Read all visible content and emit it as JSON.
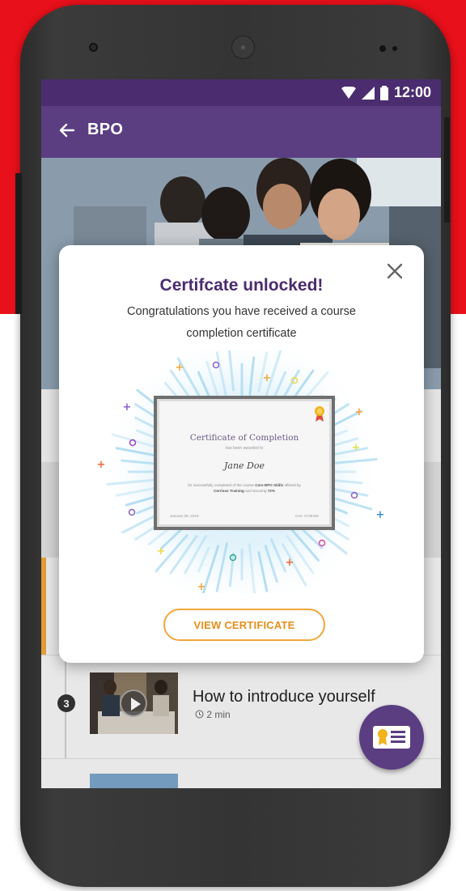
{
  "status_bar": {
    "time": "12:00"
  },
  "app_bar": {
    "title": "BPO"
  },
  "modal": {
    "title": "Certifcate unlocked!",
    "message": "Congratulations you have received a course completion certificate",
    "button_label": "VIEW CERTIFICATE"
  },
  "certificate": {
    "heading": "Certificate of Completion",
    "subheading": "has been awarded to",
    "recipient": "Jane Doe",
    "body_prefix": "for successfully completed of the course",
    "course": "Core BPO Skills",
    "offered_by_text": "offered by",
    "provider": "Cerrisus Training",
    "scoring_text": "and securing",
    "score": "72%",
    "date": "January 09, 2018",
    "cert_id": "Cert. 0738436"
  },
  "lesson": {
    "step_number": "3",
    "title": "How to introduce yourself",
    "duration": "2 min"
  },
  "colors": {
    "primary": "#5b3d82",
    "status_bar": "#4a2c6f",
    "accent": "#f2a73b",
    "background_red": "#e8101a"
  },
  "icons": {
    "back": "arrow-left-icon",
    "close": "close-icon",
    "fab": "certificate-badge-icon",
    "duration": "clock-icon",
    "play": "play-icon"
  }
}
